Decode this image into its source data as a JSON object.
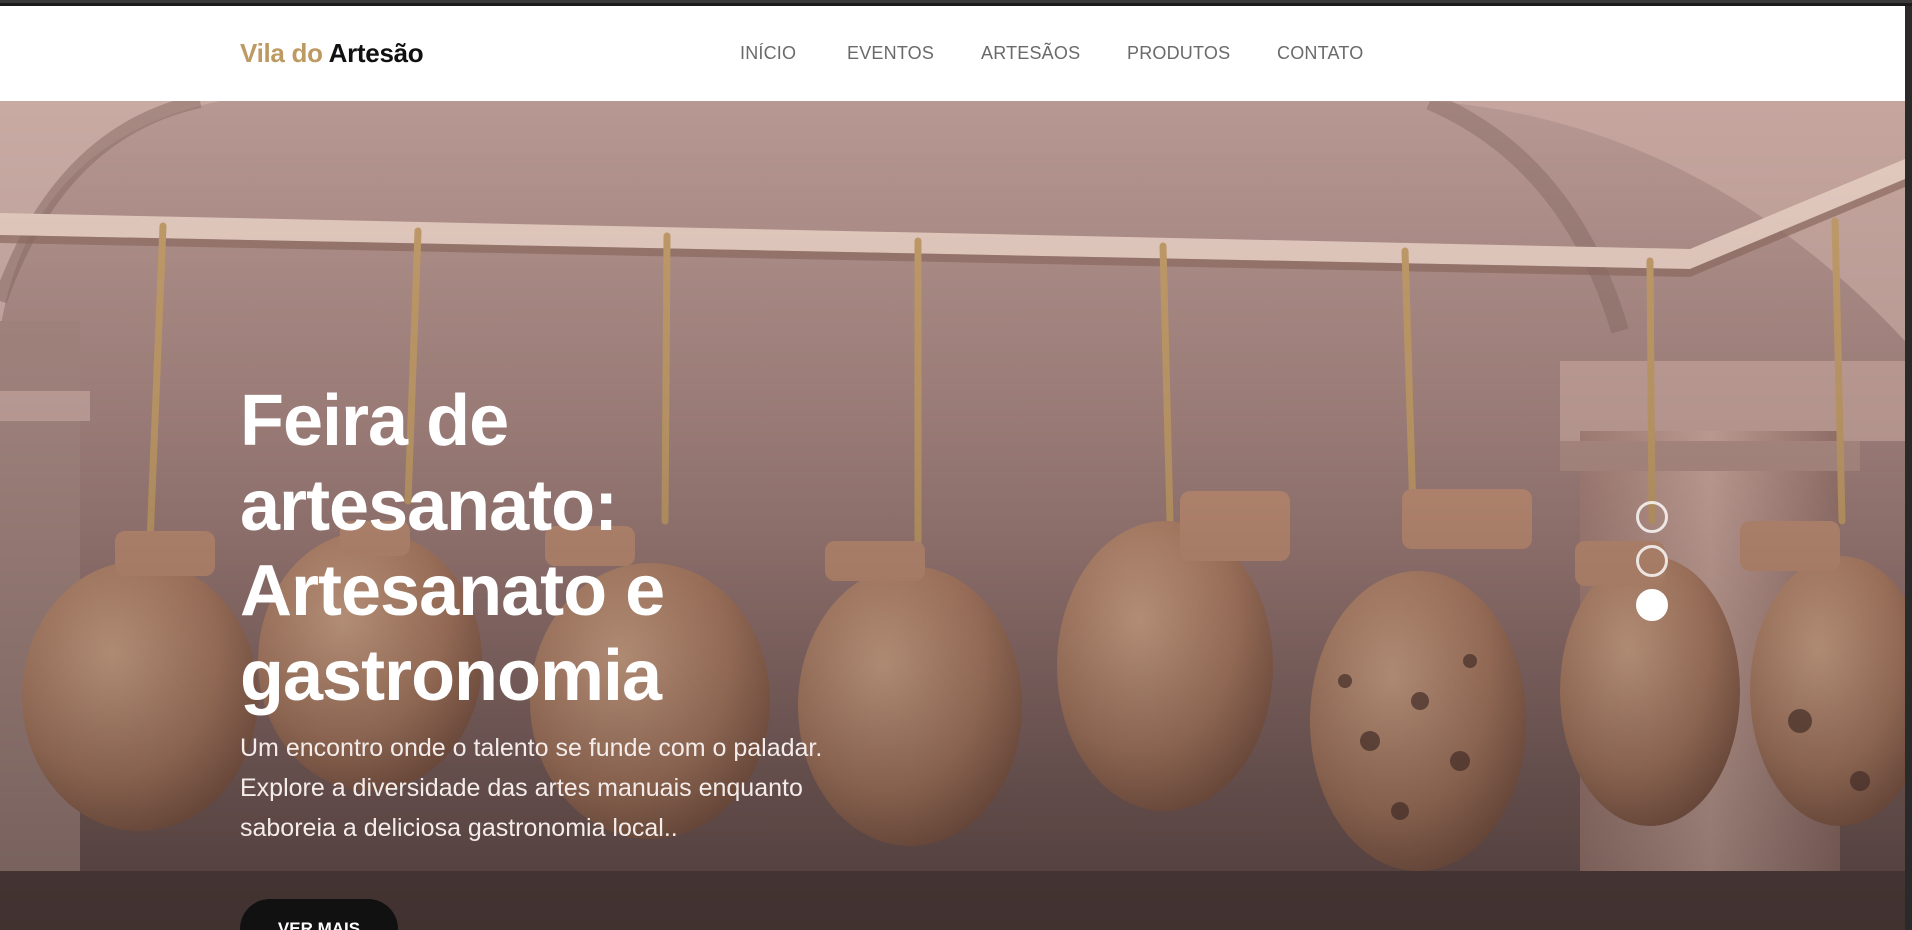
{
  "site": {
    "logo_accent": "Vila do",
    "logo_main": "Artesão",
    "accent_color": "#bc9a62"
  },
  "nav": {
    "items": [
      {
        "label": "INÍCIO"
      },
      {
        "label": "EVENTOS"
      },
      {
        "label": "ARTESÃOS"
      },
      {
        "label": "PRODUTOS"
      },
      {
        "label": "CONTATO"
      }
    ]
  },
  "hero": {
    "title_lines": [
      "Feira de",
      "artesanato:",
      "Artesanato e",
      "gastronomia"
    ],
    "text_lines": [
      "Um encontro onde o talento se funde com o paladar.",
      "Explore a diversidade das artes manuais enquanto",
      "saboreia a deliciosa gastronomia local.."
    ],
    "button_label": "VER MAIS",
    "slider": {
      "count": 3,
      "active": 3
    }
  }
}
